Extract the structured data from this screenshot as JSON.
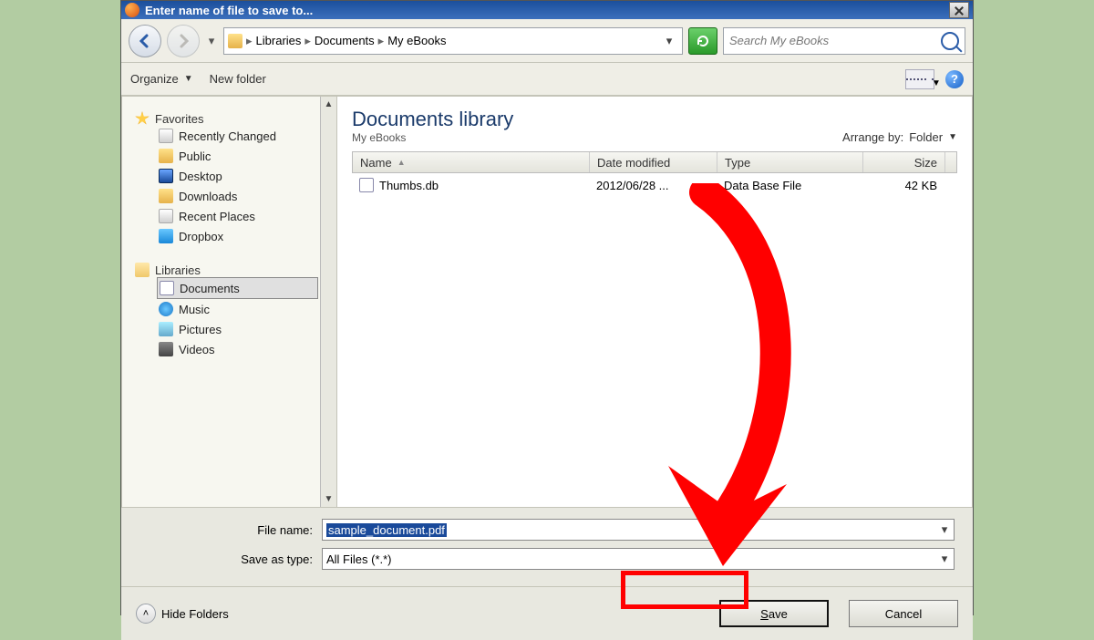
{
  "titlebar": {
    "text": "Enter name of file to save to..."
  },
  "breadcrumb": {
    "root_icon": "folder",
    "segments": [
      "Libraries",
      "Documents",
      "My eBooks"
    ]
  },
  "search": {
    "placeholder": "Search My eBooks"
  },
  "toolbar": {
    "organize": "Organize",
    "newfolder": "New folder"
  },
  "navpane": {
    "favorites": {
      "label": "Favorites",
      "items": [
        {
          "label": "Recently Changed",
          "icon": "recent"
        },
        {
          "label": "Public",
          "icon": "folder"
        },
        {
          "label": "Desktop",
          "icon": "desktop"
        },
        {
          "label": "Downloads",
          "icon": "download"
        },
        {
          "label": "Recent Places",
          "icon": "recent"
        },
        {
          "label": "Dropbox",
          "icon": "dropbox"
        }
      ]
    },
    "libraries": {
      "label": "Libraries",
      "items": [
        {
          "label": "Documents",
          "icon": "doc",
          "selected": true
        },
        {
          "label": "Music",
          "icon": "music"
        },
        {
          "label": "Pictures",
          "icon": "pic"
        },
        {
          "label": "Videos",
          "icon": "vid"
        }
      ]
    }
  },
  "library": {
    "title": "Documents library",
    "subtitle": "My eBooks",
    "arrange_label": "Arrange by:",
    "arrange_value": "Folder"
  },
  "columns": {
    "name": "Name",
    "date": "Date modified",
    "type": "Type",
    "size": "Size"
  },
  "files": [
    {
      "name": "Thumbs.db",
      "date": "2012/06/28 ...",
      "type": "Data Base File",
      "size": "42 KB"
    }
  ],
  "fields": {
    "filename_label": "File name:",
    "filename_value": "sample_document.pdf",
    "saveastype_label": "Save as type:",
    "saveastype_value": "All Files (*.*)"
  },
  "footer": {
    "hide_folders": "Hide Folders",
    "save": "Save",
    "cancel": "Cancel"
  }
}
